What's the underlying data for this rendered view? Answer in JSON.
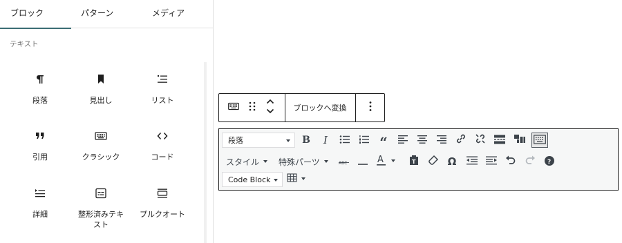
{
  "inserter": {
    "tabs": [
      {
        "label": "ブロック",
        "active": true
      },
      {
        "label": "パターン",
        "active": false
      },
      {
        "label": "メディア",
        "active": false
      }
    ],
    "section_title": "テキスト",
    "blocks": [
      {
        "label": "段落",
        "icon": "paragraph-icon"
      },
      {
        "label": "見出し",
        "icon": "heading-bookmark-icon"
      },
      {
        "label": "リスト",
        "icon": "list-icon"
      },
      {
        "label": "引用",
        "icon": "quote-icon"
      },
      {
        "label": "クラシック",
        "icon": "keyboard-icon"
      },
      {
        "label": "コード",
        "icon": "code-icon"
      },
      {
        "label": "詳細",
        "icon": "details-icon"
      },
      {
        "label": "整形済みテキスト",
        "label_line1": "整形済みテキ",
        "label_line2": "スト",
        "icon": "preformatted-icon"
      },
      {
        "label": "プルクオート",
        "icon": "pullquote-icon"
      }
    ]
  },
  "block_toolbar": {
    "transform_label": "ブロックへ変換",
    "icons": [
      "keyboard-icon",
      "drag-handle-icon",
      "move-up-down-icon",
      "more-options-icon"
    ]
  },
  "classic_toolbar": {
    "format_select": "段落",
    "style_menu": "スタイル",
    "special_chars_menu": "特殊パーツ",
    "code_block_select": "Code Block",
    "buttons_row1": [
      "bold",
      "italic",
      "bullet-list",
      "numbered-list",
      "blockquote",
      "align-left",
      "align-center",
      "align-right",
      "link",
      "unlink",
      "read-more",
      "toolbar-toggle",
      "keyboard-toggle"
    ],
    "buttons_row2": [
      "strikethrough",
      "horizontal-rule",
      "text-color",
      "paste-as-text",
      "clear-formatting",
      "special-character",
      "outdent",
      "indent",
      "undo",
      "redo",
      "help"
    ],
    "buttons_row3": [
      "table"
    ]
  },
  "colors": {
    "accent": "#3b6d74",
    "border": "#1e1e1e",
    "toolbar_bg": "#f6f7f7",
    "label_gray": "#757575"
  }
}
